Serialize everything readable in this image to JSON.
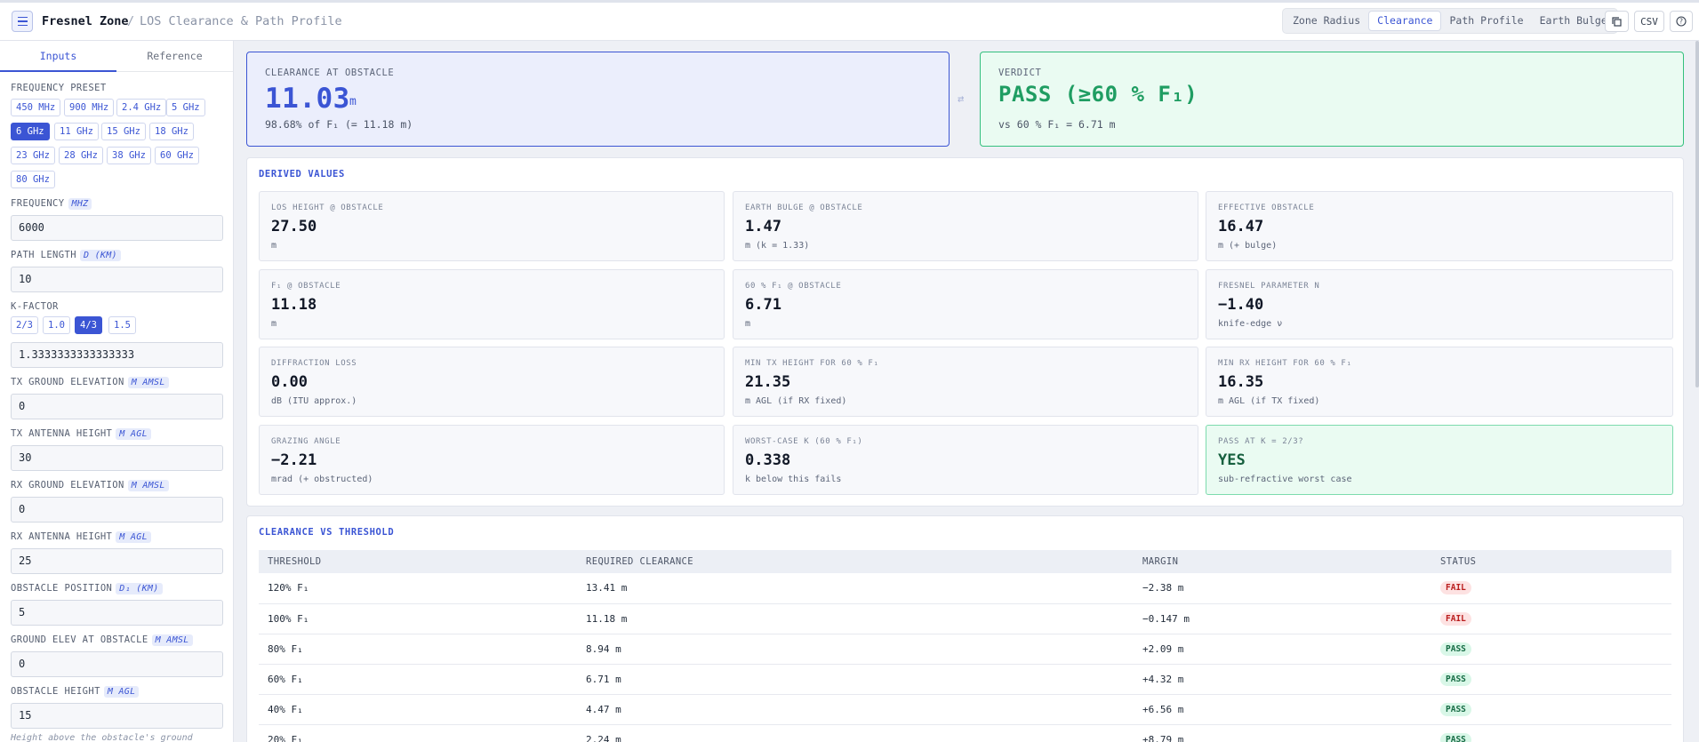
{
  "header": {
    "app_title": "Fresnel Zone",
    "separator": "/",
    "subtitle": "LOS Clearance & Path Profile",
    "tabs": [
      {
        "label": "Zone Radius",
        "active": false
      },
      {
        "label": "Clearance",
        "active": true
      },
      {
        "label": "Path Profile",
        "active": false
      },
      {
        "label": "Earth Bulge",
        "active": false
      }
    ],
    "csv_label": "CSV",
    "help_label": "?"
  },
  "sidebar": {
    "tabs": [
      "Inputs",
      "Reference"
    ],
    "active_tab": "Inputs",
    "frequency_preset_label": "FREQUENCY PRESET",
    "frequency_presets": [
      "450 MHz",
      "900 MHz",
      "2.4 GHz",
      "5 GHz",
      "6 GHz",
      "11 GHz",
      "15 GHz",
      "18 GHz",
      "23 GHz",
      "28 GHz",
      "38 GHz",
      "60 GHz",
      "80 GHz"
    ],
    "selected_preset": "6 GHz",
    "fields": {
      "frequency": {
        "label": "FREQUENCY",
        "unit": "MHZ",
        "value": "6000"
      },
      "path_length": {
        "label": "PATH LENGTH",
        "unit": "D (KM)",
        "value": "10"
      },
      "k_factor": {
        "label": "K-FACTOR",
        "value": "1.3333333333333333",
        "options": [
          "2/3",
          "1.0",
          "4/3",
          "1.5"
        ],
        "selected": "4/3"
      },
      "tx_ground": {
        "label": "TX GROUND ELEVATION",
        "unit": "M AMSL",
        "value": "0"
      },
      "tx_antenna": {
        "label": "TX ANTENNA HEIGHT",
        "unit": "M AGL",
        "value": "30"
      },
      "rx_ground": {
        "label": "RX GROUND ELEVATION",
        "unit": "M AMSL",
        "value": "0"
      },
      "rx_antenna": {
        "label": "RX ANTENNA HEIGHT",
        "unit": "M AGL",
        "value": "25"
      },
      "obstacle_position": {
        "label": "OBSTACLE POSITION",
        "unit": "D₁ (KM)",
        "value": "5"
      },
      "ground_elev_obstacle": {
        "label": "GROUND ELEV AT OBSTACLE",
        "unit": "M AMSL",
        "value": "0"
      },
      "obstacle_height": {
        "label": "OBSTACLE HEIGHT",
        "unit": "M AGL",
        "value": "15"
      }
    },
    "hint": "Height above the obstacle's ground"
  },
  "summary": {
    "clearance_label": "CLEARANCE AT OBSTACLE",
    "clearance_value": "11.03",
    "clearance_unit": "m",
    "clearance_sub": "98.68% of F₁ (= 11.18 m)",
    "swap_icon": "⇄",
    "verdict_label": "VERDICT",
    "verdict_value": "PASS (≥60 % F₁)",
    "verdict_sub": "vs 60 % F₁ = 6.71 m"
  },
  "derived": {
    "title": "DERIVED VALUES",
    "cells": [
      {
        "label": "LOS HEIGHT @ OBSTACLE",
        "value": "27.50",
        "sub": "m"
      },
      {
        "label": "EARTH BULGE @ OBSTACLE",
        "value": "1.47",
        "sub": "m (k = 1.33)"
      },
      {
        "label": "EFFECTIVE OBSTACLE",
        "value": "16.47",
        "sub": "m (+ bulge)"
      },
      {
        "label": "F₁ @ OBSTACLE",
        "value": "11.18",
        "sub": "m"
      },
      {
        "label": "60 % F₁ @ OBSTACLE",
        "value": "6.71",
        "sub": "m"
      },
      {
        "label": "FRESNEL PARAMETER N",
        "value": "−1.40",
        "sub": "knife-edge ν"
      },
      {
        "label": "DIFFRACTION LOSS",
        "value": "0.00",
        "sub": "dB (ITU approx.)"
      },
      {
        "label": "MIN TX HEIGHT FOR 60 % F₁",
        "value": "21.35",
        "sub": "m AGL (if RX fixed)"
      },
      {
        "label": "MIN RX HEIGHT FOR 60 % F₁",
        "value": "16.35",
        "sub": "m AGL (if TX fixed)"
      },
      {
        "label": "GRAZING ANGLE",
        "value": "−2.21",
        "sub": "mrad (+ obstructed)"
      },
      {
        "label": "WORST-CASE K (60 % F₁)",
        "value": "0.338",
        "sub": "k below this fails"
      },
      {
        "label": "PASS AT K = 2/3?",
        "value": "YES",
        "sub": "sub-refractive worst case"
      }
    ]
  },
  "threshold": {
    "title": "CLEARANCE VS THRESHOLD",
    "columns": [
      "THRESHOLD",
      "REQUIRED CLEARANCE",
      "MARGIN",
      "STATUS"
    ],
    "rows": [
      {
        "threshold": "120% F₁",
        "required": "13.41 m",
        "margin": "−2.38 m",
        "status": "FAIL"
      },
      {
        "threshold": "100% F₁",
        "required": "11.18 m",
        "margin": "−0.147 m",
        "status": "FAIL"
      },
      {
        "threshold": "80% F₁",
        "required": "8.94 m",
        "margin": "+2.09 m",
        "status": "PASS"
      },
      {
        "threshold": "60% F₁",
        "required": "6.71 m",
        "margin": "+4.32 m",
        "status": "PASS"
      },
      {
        "threshold": "40% F₁",
        "required": "4.47 m",
        "margin": "+6.56 m",
        "status": "PASS"
      },
      {
        "threshold": "20% F₁",
        "required": "2.24 m",
        "margin": "+8.79 m",
        "status": "PASS"
      }
    ]
  },
  "colors": {
    "accent": "#3b55d4",
    "pass": "#1f9d62",
    "fail": "#b91c1c"
  }
}
